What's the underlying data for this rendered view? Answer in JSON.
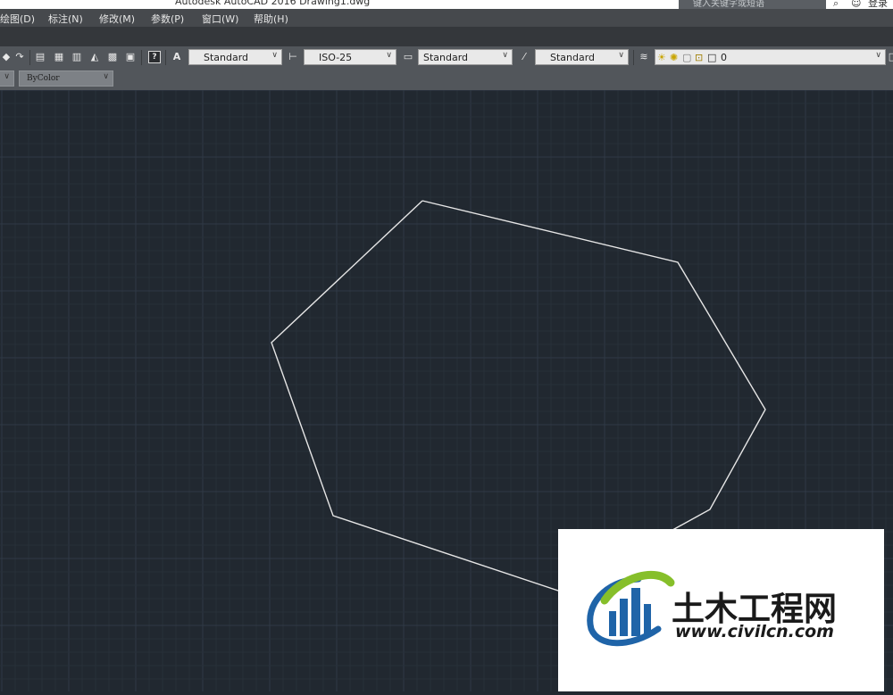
{
  "window": {
    "title": "Autodesk AutoCAD 2016    Drawing1.dwg",
    "search_placeholder": "键入关键字或短语",
    "login_label": "登录"
  },
  "menu": {
    "items": [
      "绘图(D)",
      "标注(N)",
      "修改(M)",
      "参数(P)",
      "窗口(W)",
      "帮助(H)"
    ]
  },
  "toolbar": {
    "text_style": "Standard",
    "dim_style": "ISO-25",
    "table_style": "Standard",
    "mleader_style": "Standard",
    "layer": "0",
    "help_icon": "?",
    "style_icon": "A"
  },
  "properties": {
    "color": "ByColor"
  },
  "canvas": {
    "background": "#212830",
    "grid_minor_color": "#283039",
    "grid_major_color": "#303946",
    "line_color": "#e6e6e6",
    "grid_visible": true
  },
  "watermark": {
    "name": "土木工程网",
    "url": "www.civilcn.com"
  }
}
